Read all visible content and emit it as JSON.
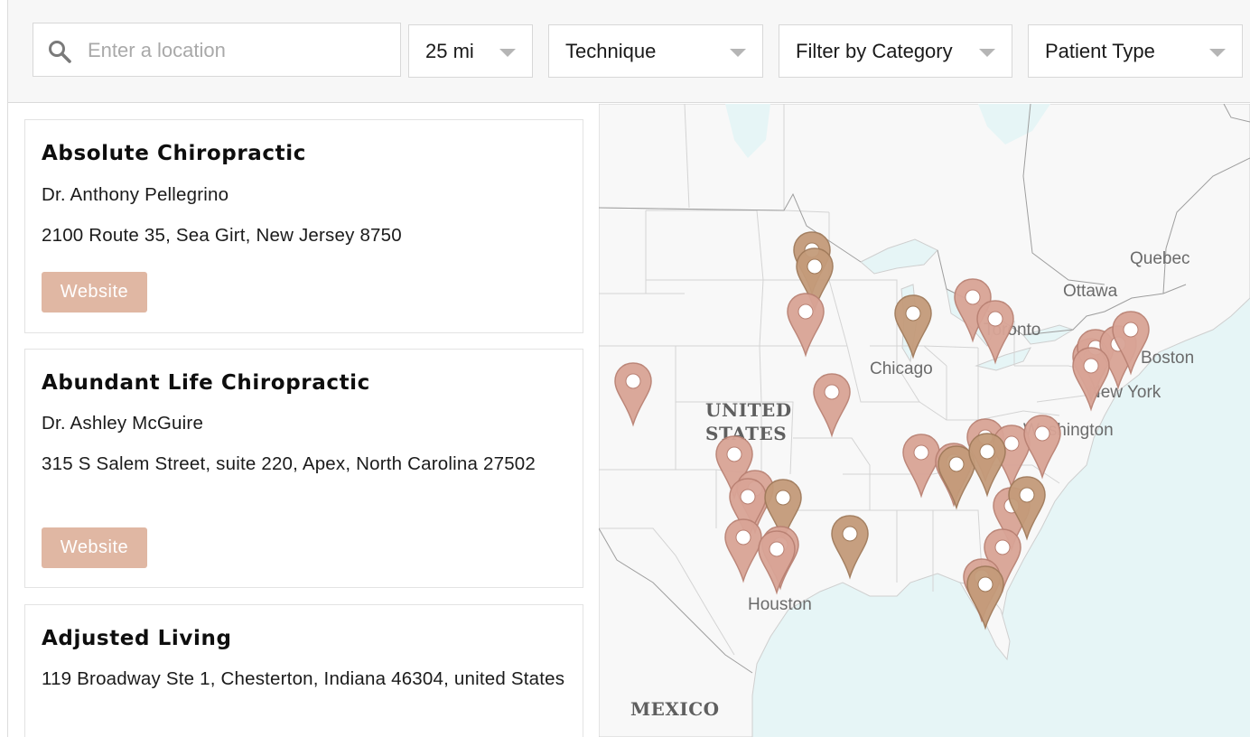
{
  "search": {
    "placeholder": "Enter a location",
    "icon": "search-icon"
  },
  "filters": {
    "radius": "25 mi",
    "technique": "Technique",
    "category": "Filter by Category",
    "patient_type": "Patient Type"
  },
  "listings": [
    {
      "name": "Absolute Chiropractic",
      "doctor": "Dr. Anthony Pellegrino",
      "address": "2100 Route 35, Sea Girt, New Jersey 8750",
      "button": "Website"
    },
    {
      "name": "Abundant Life Chiropractic",
      "doctor": "Dr. Ashley McGuire",
      "address": "315 S Salem Street, suite 220, Apex, North Carolina 27502",
      "button": "Website"
    },
    {
      "name": "Adjusted Living",
      "address": "119 Broadway Ste 1, Chesterton, Indiana 46304, united States"
    }
  ],
  "map": {
    "labels": {
      "united": "United",
      "states": "States",
      "mexico": "Mexico",
      "quebec": "Quebec",
      "ottawa": "Ottawa",
      "toronto": "Toronto",
      "boston": "Boston",
      "new_york": "New York",
      "washington": "Washington",
      "chicago": "Chicago",
      "houston": "Houston"
    },
    "colors": {
      "land": "#f8f8f8",
      "water": "#e6f5f6",
      "pin_pink": "#d9a496",
      "pin_tan": "#c49b7a",
      "website_button": "#e0b7a3"
    }
  }
}
